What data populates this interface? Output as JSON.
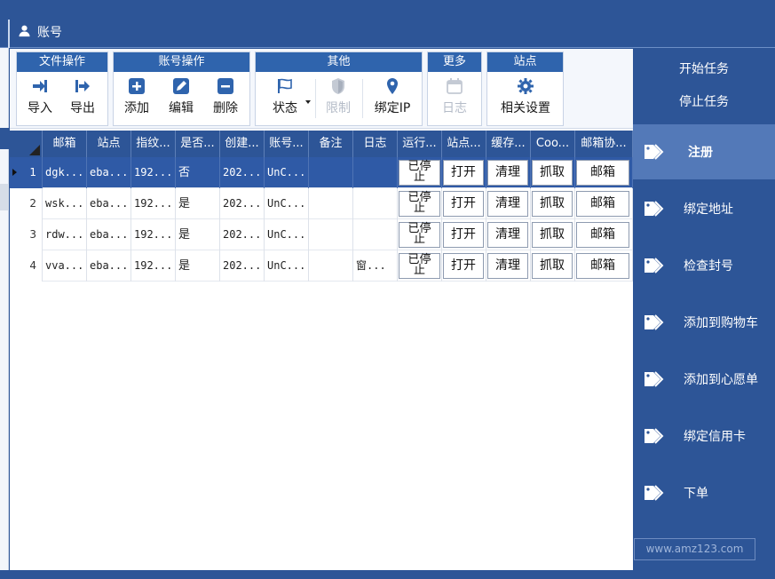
{
  "window": {
    "title": "账号"
  },
  "ribbon": {
    "file_ops": {
      "header": "文件操作",
      "import": "导入",
      "export": "导出"
    },
    "account_ops": {
      "header": "账号操作",
      "add": "添加",
      "edit": "编辑",
      "delete": "删除"
    },
    "other": {
      "header": "其他",
      "status": "状态",
      "limit": "限制",
      "bind_ip": "绑定IP"
    },
    "more": {
      "header": "更多",
      "log": "日志"
    },
    "site": {
      "header": "站点",
      "settings": "相关设置"
    }
  },
  "table": {
    "headers": [
      "邮箱",
      "站点",
      "指纹...",
      "是否...",
      "创建...",
      "账号...",
      "备注",
      "日志",
      "运行...",
      "站点...",
      "缓存...",
      "Coo...",
      "邮箱协..."
    ],
    "rows": [
      {
        "num": "1",
        "email": "dgk...",
        "site": "eba...",
        "fp": "192...",
        "flag": "否",
        "created": "202...",
        "account": "UnC...",
        "note": "",
        "log": "",
        "run": "已停止",
        "open": "打开",
        "clear": "清理",
        "grab": "抓取",
        "mail": "邮箱"
      },
      {
        "num": "2",
        "email": "wsk...",
        "site": "eba...",
        "fp": "192...",
        "flag": "是",
        "created": "202...",
        "account": "UnC...",
        "note": "",
        "log": "",
        "run": "已停止",
        "open": "打开",
        "clear": "清理",
        "grab": "抓取",
        "mail": "邮箱"
      },
      {
        "num": "3",
        "email": "rdw...",
        "site": "eba...",
        "fp": "192...",
        "flag": "是",
        "created": "202...",
        "account": "UnC...",
        "note": "",
        "log": "",
        "run": "已停止",
        "open": "打开",
        "clear": "清理",
        "grab": "抓取",
        "mail": "邮箱"
      },
      {
        "num": "4",
        "email": "vva...",
        "site": "eba...",
        "fp": "192...",
        "flag": "是",
        "created": "202...",
        "account": "UnC...",
        "note": "",
        "log": "窗...",
        "run": "已停止",
        "open": "打开",
        "clear": "清理",
        "grab": "抓取",
        "mail": "邮箱"
      }
    ]
  },
  "sidebar": {
    "start_task": "开始任务",
    "stop_task": "停止任务",
    "items": [
      "注册",
      "绑定地址",
      "检查封号",
      "添加到购物车",
      "添加到心愿单",
      "绑定信用卡",
      "下单"
    ],
    "active_index": 0,
    "watermark": "www.amz123.com"
  },
  "colors": {
    "primary": "#2d5597",
    "header_blue": "#2f64ad",
    "active_item": "#5379b8"
  },
  "icons": [
    "user-icon",
    "import-icon",
    "export-icon",
    "plus-icon",
    "edit-icon",
    "minus-icon",
    "flag-icon",
    "shield-icon",
    "pin-icon",
    "calendar-icon",
    "gear-icon",
    "tag-icon"
  ]
}
